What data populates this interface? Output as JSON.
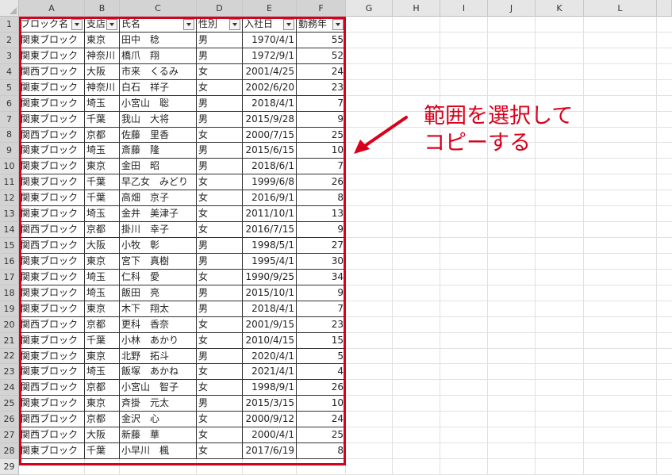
{
  "columns": [
    "A",
    "B",
    "C",
    "D",
    "E",
    "F",
    "G",
    "H",
    "I",
    "J",
    "K",
    "L"
  ],
  "rows_visible": 29,
  "table": {
    "headers": [
      "ブロック名",
      "支店",
      "氏名",
      "性別",
      "入社日",
      "勤務年"
    ],
    "rows": [
      [
        "関東ブロック",
        "東京",
        "田中　稔",
        "男",
        "1970/4/1",
        "55"
      ],
      [
        "関東ブロック",
        "神奈川",
        "橋爪　翔",
        "男",
        "1972/9/1",
        "52"
      ],
      [
        "関西ブロック",
        "大阪",
        "市来　くるみ",
        "女",
        "2001/4/25",
        "24"
      ],
      [
        "関東ブロック",
        "神奈川",
        "白石　祥子",
        "女",
        "2002/6/20",
        "23"
      ],
      [
        "関東ブロック",
        "埼玉",
        "小宮山　聡",
        "男",
        "2018/4/1",
        "7"
      ],
      [
        "関東ブロック",
        "千葉",
        "我山　大将",
        "男",
        "2015/9/28",
        "9"
      ],
      [
        "関西ブロック",
        "京都",
        "佐藤　里香",
        "女",
        "2000/7/15",
        "25"
      ],
      [
        "関東ブロック",
        "埼玉",
        "斎藤　隆",
        "男",
        "2015/6/15",
        "10"
      ],
      [
        "関東ブロック",
        "東京",
        "金田　昭",
        "男",
        "2018/6/1",
        "7"
      ],
      [
        "関東ブロック",
        "千葉",
        "早乙女　みどり",
        "女",
        "1999/6/8",
        "26"
      ],
      [
        "関東ブロック",
        "千葉",
        "高畑　京子",
        "女",
        "2016/9/1",
        "8"
      ],
      [
        "関東ブロック",
        "埼玉",
        "金井　美津子",
        "女",
        "2011/10/1",
        "13"
      ],
      [
        "関西ブロック",
        "京都",
        "掛川　幸子",
        "女",
        "2016/7/15",
        "9"
      ],
      [
        "関西ブロック",
        "大阪",
        "小牧　彰",
        "男",
        "1998/5/1",
        "27"
      ],
      [
        "関東ブロック",
        "東京",
        "宮下　真樹",
        "男",
        "1995/4/1",
        "30"
      ],
      [
        "関東ブロック",
        "埼玉",
        "仁科　愛",
        "女",
        "1990/9/25",
        "34"
      ],
      [
        "関東ブロック",
        "埼玉",
        "飯田　亮",
        "男",
        "2015/10/1",
        "9"
      ],
      [
        "関東ブロック",
        "東京",
        "木下　翔太",
        "男",
        "2018/4/1",
        "7"
      ],
      [
        "関西ブロック",
        "京都",
        "更科　香奈",
        "女",
        "2001/9/15",
        "23"
      ],
      [
        "関東ブロック",
        "千葉",
        "小林　あかり",
        "女",
        "2010/4/15",
        "15"
      ],
      [
        "関東ブロック",
        "東京",
        "北野　拓斗",
        "男",
        "2020/4/1",
        "5"
      ],
      [
        "関東ブロック",
        "埼玉",
        "飯塚　あかね",
        "女",
        "2021/4/1",
        "4"
      ],
      [
        "関西ブロック",
        "京都",
        "小宮山　智子",
        "女",
        "1998/9/1",
        "26"
      ],
      [
        "関東ブロック",
        "東京",
        "斉掛　元太",
        "男",
        "2015/3/15",
        "10"
      ],
      [
        "関西ブロック",
        "京都",
        "金沢　心",
        "女",
        "2000/9/12",
        "24"
      ],
      [
        "関西ブロック",
        "大阪",
        "新藤　華",
        "女",
        "2000/4/1",
        "25"
      ],
      [
        "関東ブロック",
        "千葉",
        "小早川　楓",
        "女",
        "2017/6/19",
        "8"
      ]
    ]
  },
  "annotation": {
    "line1": "範囲を選択して",
    "line2": "コピーする",
    "color": "#d9001b"
  }
}
